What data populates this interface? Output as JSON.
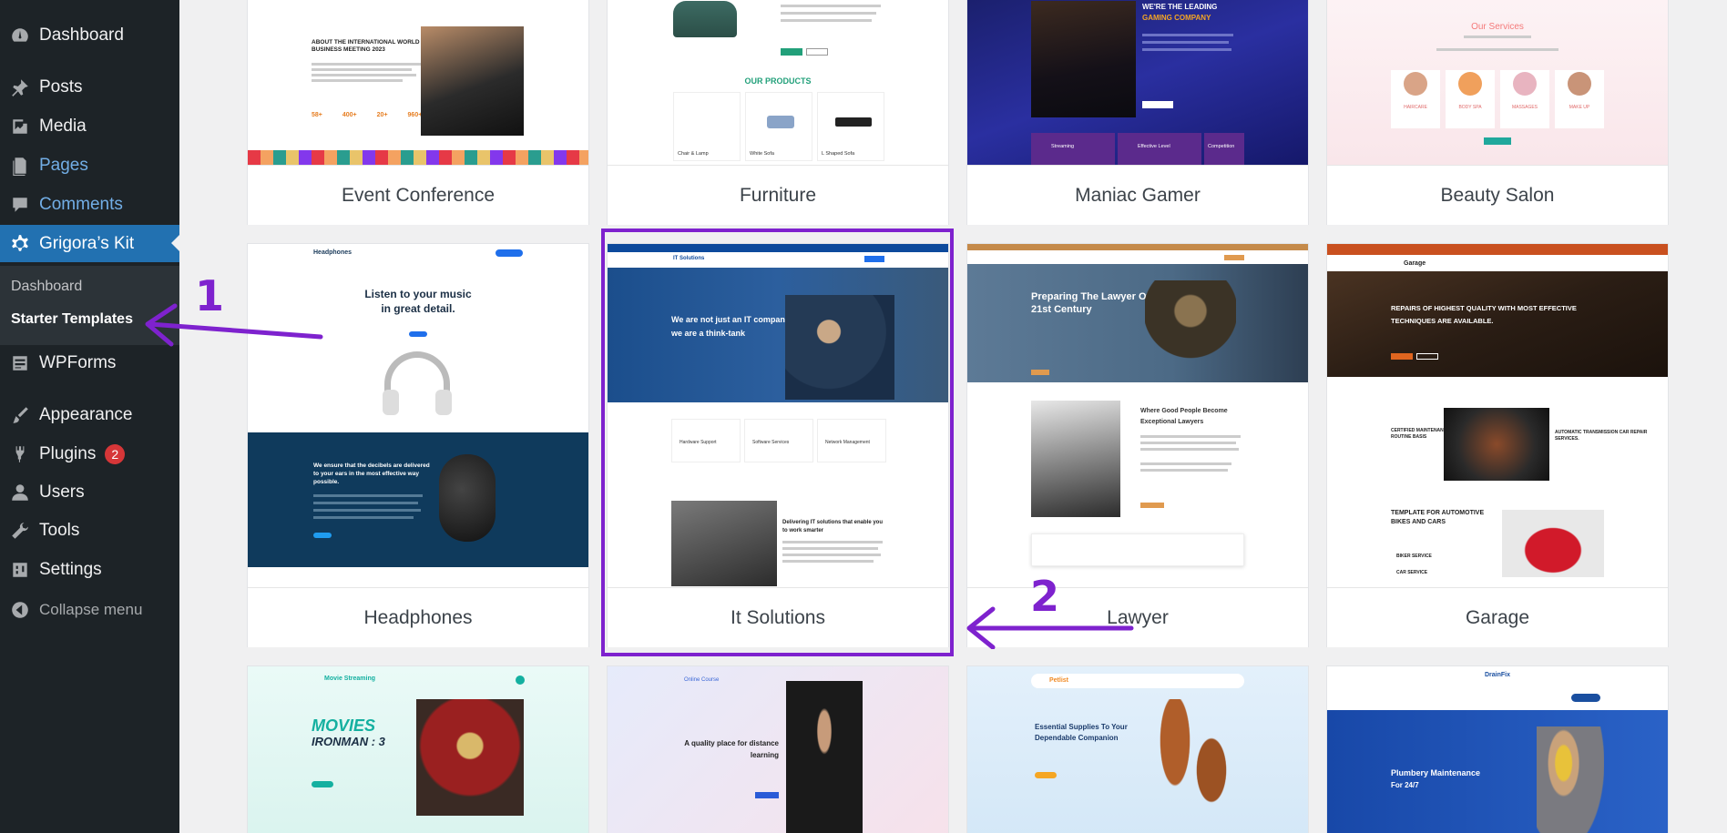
{
  "sidebar": {
    "items": [
      {
        "label": "Dashboard",
        "icon": "dashboard-icon"
      },
      {
        "label": "Posts",
        "icon": "pin-icon"
      },
      {
        "label": "Media",
        "icon": "media-icon"
      },
      {
        "label": "Pages",
        "icon": "pages-icon"
      },
      {
        "label": "Comments",
        "icon": "comment-icon"
      },
      {
        "label": "Grigora’s Kit",
        "icon": "gear-icon"
      },
      {
        "label": "WPForms",
        "icon": "forms-icon"
      },
      {
        "label": "Appearance",
        "icon": "brush-icon"
      },
      {
        "label": "Plugins",
        "icon": "plug-icon",
        "badge": "2"
      },
      {
        "label": "Users",
        "icon": "user-icon"
      },
      {
        "label": "Tools",
        "icon": "wrench-icon"
      },
      {
        "label": "Settings",
        "icon": "settings-icon"
      },
      {
        "label": "Collapse menu",
        "icon": "collapse-icon"
      }
    ],
    "submenu": [
      "Dashboard",
      "Starter Templates"
    ]
  },
  "templates": {
    "row1": [
      "Event Conference",
      "Furniture",
      "Maniac Gamer",
      "Beauty Salon"
    ],
    "row2": [
      "Headphones",
      "It Solutions",
      "Lawyer",
      "Garage"
    ]
  },
  "annotations": {
    "one": "1",
    "two": "2"
  },
  "previews": {
    "event": {
      "heading": "ABOUT THE INTERNATIONAL WORLD IT BUSINESS MEETING 2023",
      "stats": [
        "58+",
        "400+",
        "20+",
        "960+"
      ]
    },
    "furniture": {
      "heading": "OUR PRODUCTS",
      "products": [
        "Chair & Lamp",
        "White Sofa",
        "L Shaped Sofa"
      ]
    },
    "gamer": {
      "line1": "WE'RE THE LEADING",
      "line2": "GAMING COMPANY",
      "features": [
        "Streaming",
        "Effective Level",
        "Competition"
      ]
    },
    "beauty": {
      "heading": "Our Services",
      "services": [
        "HAIRCARE",
        "BODY SPA",
        "MASSAGES",
        "MAKE UP"
      ]
    },
    "headphones": {
      "brand": "Headphones",
      "hero1": "Listen to your music",
      "hero2": "in great detail.",
      "band": "We ensure that the decibels are delivered to your ears in the most effective way possible."
    },
    "it": {
      "brand": "IT Solutions",
      "hero1": "We are not just an IT company,",
      "hero2": "we are a think-tank",
      "services": [
        "Hardware Support",
        "Software Services",
        "Network Management"
      ],
      "sub": "Delivering IT solutions that enable you to work smarter"
    },
    "lawyer": {
      "hero1": "Preparing The Lawyer Of",
      "hero2": "21st Century",
      "sub1": "Where Good People Become",
      "sub2": "Exceptional Lawyers"
    },
    "garage": {
      "brand": "Garage",
      "hero1": "REPAIRS OF HIGHEST QUALITY WITH MOST EFFECTIVE",
      "hero2": "TECHNIQUES ARE AVAILABLE.",
      "s1": "CERTIFIED MAINTENANCE REPAIRS ON A ROUTINE BASIS",
      "s2": "AUTOMATIC TRANSMISSION CAR REPAIR SERVICES.",
      "t1": "TEMPLATE FOR AUTOMOTIVE",
      "t2": "BIKES AND CARS",
      "bike": "BIKER SERVICE",
      "car": "CAR SERVICE"
    },
    "movie": {
      "brand": "Movie Streaming",
      "t1": "MOVIES",
      "t2": "IRONMAN : 3"
    },
    "course": {
      "brand": "Online Course",
      "t1": "A quality place for distance",
      "t2": "learning"
    },
    "pet": {
      "brand": "Petlist",
      "t1": "Essential Supplies To Your",
      "t2": "Dependable Companion"
    },
    "plumb": {
      "brand": "DrainFix",
      "t1": "Plumbery Maintenance",
      "t2": "For 24/7"
    }
  },
  "colors": {
    "sidebar": "#1d2327",
    "accent": "#2271b1",
    "highlight": "#7e22ce"
  }
}
